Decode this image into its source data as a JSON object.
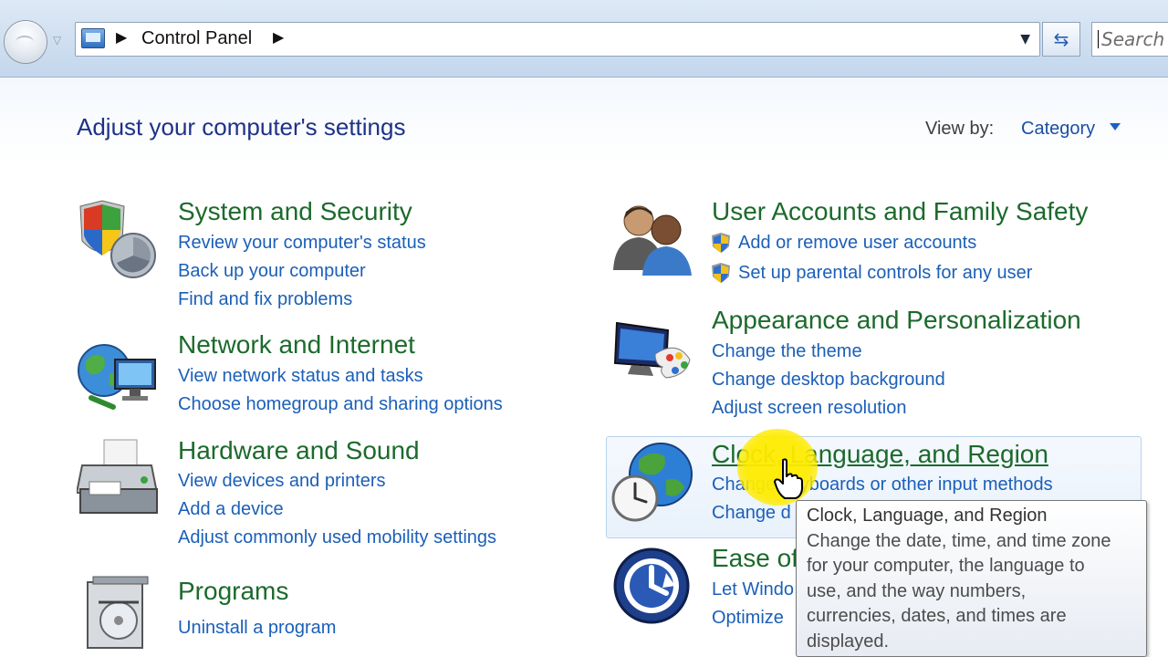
{
  "address_bar": {
    "breadcrumb": "Control Panel",
    "search_placeholder": "Search"
  },
  "header": {
    "title": "Adjust your computer's settings",
    "view_by_label": "View by:",
    "view_by_value": "Category"
  },
  "categories": {
    "system_security": {
      "title": "System and Security",
      "links": [
        "Review your computer's status",
        "Back up your computer",
        "Find and fix problems"
      ]
    },
    "network_internet": {
      "title": "Network and Internet",
      "links": [
        "View network status and tasks",
        "Choose homegroup and sharing options"
      ]
    },
    "hardware_sound": {
      "title": "Hardware and Sound",
      "links": [
        "View devices and printers",
        "Add a device",
        "Adjust commonly used mobility settings"
      ]
    },
    "programs": {
      "title": "Programs",
      "links": [
        "Uninstall a program"
      ]
    },
    "user_accounts": {
      "title": "User Accounts and Family Safety",
      "links": [
        "Add or remove user accounts",
        "Set up parental controls for any user"
      ]
    },
    "appearance": {
      "title": "Appearance and Personalization",
      "links": [
        "Change the theme",
        "Change desktop background",
        "Adjust screen resolution"
      ]
    },
    "clock_region": {
      "title": "Clock, Language, and Region",
      "links": [
        "Change keyboards or other input methods",
        "Change d"
      ]
    },
    "ease_of_access": {
      "title": "Ease of",
      "links": [
        "Let Windo",
        "Optimize"
      ]
    }
  },
  "tooltip": {
    "title": "Clock, Language, and Region",
    "lines": [
      "Change the date, time, and time zone",
      "for your computer, the language to",
      "use, and the way numbers,",
      "currencies, dates, and times are",
      "displayed."
    ]
  }
}
